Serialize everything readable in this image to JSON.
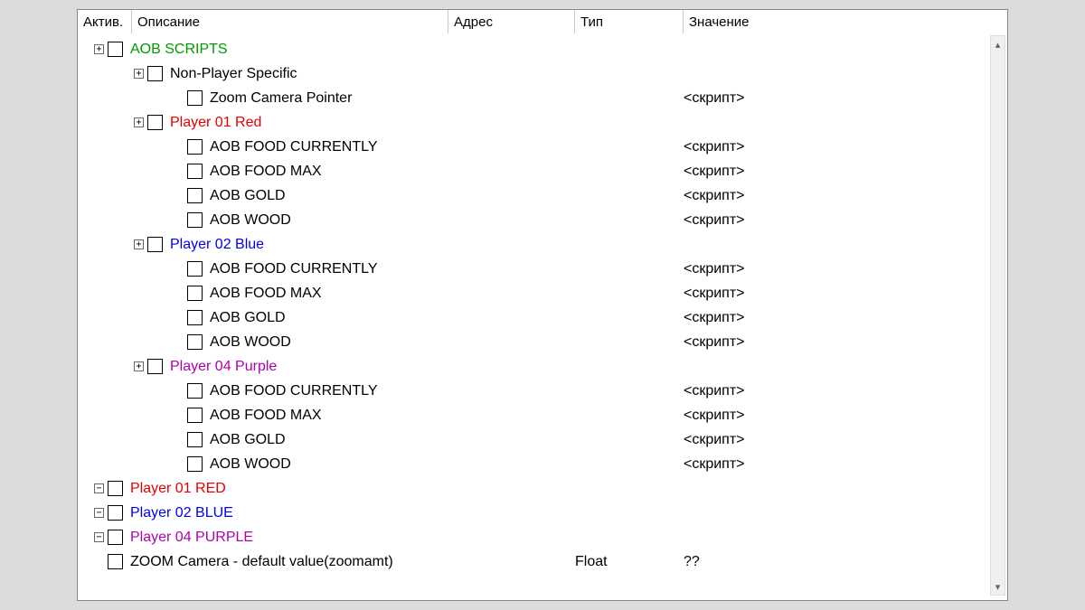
{
  "headers": {
    "active": "Актив.",
    "description": "Описание",
    "address": "Адрес",
    "type": "Тип",
    "value": "Значение"
  },
  "script_label": "<скрипт>",
  "rows": [
    {
      "indent": 0,
      "expander": "+",
      "checkbox": true,
      "label": "AOB SCRIPTS",
      "color": "green",
      "type": "",
      "value": ""
    },
    {
      "indent": 1,
      "expander": "+",
      "checkbox": true,
      "label": "Non-Player Specific",
      "color": "black",
      "type": "",
      "value": ""
    },
    {
      "indent": 2,
      "expander": "",
      "checkbox": true,
      "label": "Zoom Camera Pointer",
      "color": "black",
      "type": "",
      "value": "<скрипт>"
    },
    {
      "indent": 1,
      "expander": "+",
      "checkbox": true,
      "label": "Player 01 Red",
      "color": "red",
      "type": "",
      "value": ""
    },
    {
      "indent": 2,
      "expander": "",
      "checkbox": true,
      "label": "AOB FOOD CURRENTLY",
      "color": "black",
      "type": "",
      "value": "<скрипт>"
    },
    {
      "indent": 2,
      "expander": "",
      "checkbox": true,
      "label": "AOB FOOD MAX",
      "color": "black",
      "type": "",
      "value": "<скрипт>"
    },
    {
      "indent": 2,
      "expander": "",
      "checkbox": true,
      "label": "AOB GOLD",
      "color": "black",
      "type": "",
      "value": "<скрипт>"
    },
    {
      "indent": 2,
      "expander": "",
      "checkbox": true,
      "label": "AOB WOOD",
      "color": "black",
      "type": "",
      "value": "<скрипт>"
    },
    {
      "indent": 1,
      "expander": "+",
      "checkbox": true,
      "label": "Player 02 Blue",
      "color": "blue",
      "type": "",
      "value": ""
    },
    {
      "indent": 2,
      "expander": "",
      "checkbox": true,
      "label": "AOB FOOD CURRENTLY",
      "color": "black",
      "type": "",
      "value": "<скрипт>"
    },
    {
      "indent": 2,
      "expander": "",
      "checkbox": true,
      "label": "AOB FOOD MAX",
      "color": "black",
      "type": "",
      "value": "<скрипт>"
    },
    {
      "indent": 2,
      "expander": "",
      "checkbox": true,
      "label": "AOB GOLD",
      "color": "black",
      "type": "",
      "value": "<скрипт>"
    },
    {
      "indent": 2,
      "expander": "",
      "checkbox": true,
      "label": "AOB WOOD",
      "color": "black",
      "type": "",
      "value": "<скрипт>"
    },
    {
      "indent": 1,
      "expander": "+",
      "checkbox": true,
      "label": "Player 04 Purple",
      "color": "purple",
      "type": "",
      "value": ""
    },
    {
      "indent": 2,
      "expander": "",
      "checkbox": true,
      "label": "AOB FOOD CURRENTLY",
      "color": "black",
      "type": "",
      "value": "<скрипт>"
    },
    {
      "indent": 2,
      "expander": "",
      "checkbox": true,
      "label": "AOB FOOD MAX",
      "color": "black",
      "type": "",
      "value": "<скрипт>"
    },
    {
      "indent": 2,
      "expander": "",
      "checkbox": true,
      "label": "AOB GOLD",
      "color": "black",
      "type": "",
      "value": "<скрипт>"
    },
    {
      "indent": 2,
      "expander": "",
      "checkbox": true,
      "label": "AOB WOOD",
      "color": "black",
      "type": "",
      "value": "<скрипт>"
    },
    {
      "indent": 0,
      "expander": "-",
      "checkbox": true,
      "label": "Player 01 RED",
      "color": "red",
      "type": "",
      "value": ""
    },
    {
      "indent": 0,
      "expander": "-",
      "checkbox": true,
      "label": "Player 02 BLUE",
      "color": "blue",
      "type": "",
      "value": ""
    },
    {
      "indent": 0,
      "expander": "-",
      "checkbox": true,
      "label": "Player 04 PURPLE",
      "color": "purple",
      "type": "",
      "value": ""
    },
    {
      "indent": 0,
      "expander": "",
      "checkbox": true,
      "label": "ZOOM Camera - default value(zoomamt)",
      "color": "black",
      "type": "Float",
      "value": "??"
    }
  ]
}
